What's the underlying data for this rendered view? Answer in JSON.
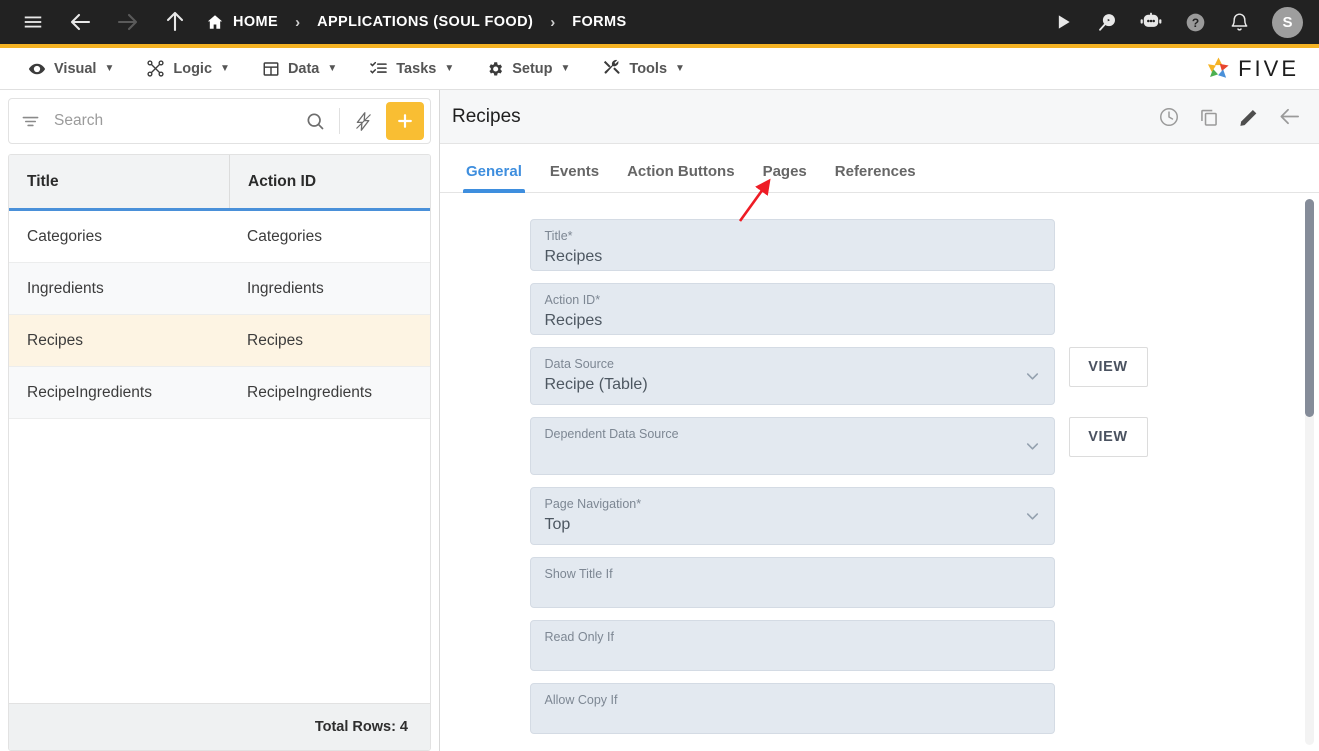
{
  "topbar": {
    "menu_icon": "hamburger-icon",
    "back_icon": "arrow-left-icon",
    "forward_icon": "arrow-right-icon",
    "up_icon": "arrow-up-icon",
    "breadcrumbs": [
      {
        "label": "HOME",
        "icon": "home-icon"
      },
      {
        "label": "APPLICATIONS (SOUL FOOD)",
        "icon": ""
      },
      {
        "label": "FORMS",
        "icon": ""
      }
    ],
    "separator": "›",
    "actions": [
      {
        "name": "run-icon",
        "label": "Run"
      },
      {
        "name": "preview-search-icon",
        "label": "Preview"
      },
      {
        "name": "robot-chat-icon",
        "label": "Assistant"
      },
      {
        "name": "help-icon",
        "label": "Help"
      },
      {
        "name": "notifications-bell-icon",
        "label": "Notifications"
      }
    ],
    "avatar_initial": "S",
    "bg_color": "#222222",
    "accent_color": "#F5B324"
  },
  "menubar": {
    "items": [
      {
        "label": "Visual",
        "icon": "eye-icon",
        "caret": "▼"
      },
      {
        "label": "Logic",
        "icon": "logic-nodes-icon",
        "caret": "▼"
      },
      {
        "label": "Data",
        "icon": "table-grid-icon",
        "caret": "▼"
      },
      {
        "label": "Tasks",
        "icon": "tasks-list-icon",
        "caret": "▼"
      },
      {
        "label": "Setup",
        "icon": "gear-icon",
        "caret": "▼"
      },
      {
        "label": "Tools",
        "icon": "tools-icon",
        "caret": "▼"
      }
    ],
    "brand": {
      "name": "five-logo-icon",
      "word": "FIVE"
    }
  },
  "sidebar": {
    "search": {
      "placeholder": "Search",
      "value": "",
      "filter_icon": "filter-icon",
      "search_icon": "search-icon",
      "bolt_icon": "lightning-bolt-icon",
      "add_icon": "plus-icon"
    },
    "table": {
      "columns": [
        "Title",
        "Action ID"
      ],
      "rows": [
        {
          "title": "Categories",
          "action_id": "Categories",
          "selected": false
        },
        {
          "title": "Ingredients",
          "action_id": "Ingredients",
          "selected": false
        },
        {
          "title": "Recipes",
          "action_id": "Recipes",
          "selected": true
        },
        {
          "title": "RecipeIngredients",
          "action_id": "RecipeIngredients",
          "selected": false
        }
      ],
      "footer": "Total Rows: 4",
      "header_underline_color": "#4a90d9",
      "selected_row_color": "#fdf4e3"
    }
  },
  "detail": {
    "title": "Recipes",
    "header_icons": [
      {
        "name": "history-clock-icon",
        "label": "History"
      },
      {
        "name": "copy-icon",
        "label": "Copy"
      },
      {
        "name": "edit-pencil-icon",
        "label": "Edit"
      },
      {
        "name": "back-arrow-icon",
        "label": "Back"
      }
    ],
    "tabs": [
      {
        "label": "General",
        "active": true
      },
      {
        "label": "Events",
        "active": false
      },
      {
        "label": "Action Buttons",
        "active": false
      },
      {
        "label": "Pages",
        "active": false
      },
      {
        "label": "References",
        "active": false
      }
    ],
    "active_tab_color": "#3e8ede",
    "fields": [
      {
        "label": "Title",
        "required": true,
        "value": "Recipes",
        "type": "text",
        "view_button": false
      },
      {
        "label": "Action ID",
        "required": true,
        "value": "Recipes",
        "type": "text",
        "view_button": false
      },
      {
        "label": "Data Source",
        "required": false,
        "value": "Recipe (Table)",
        "type": "select",
        "view_button": true
      },
      {
        "label": "Dependent Data Source",
        "required": false,
        "value": "",
        "type": "select",
        "view_button": true
      },
      {
        "label": "Page Navigation",
        "required": true,
        "value": "Top",
        "type": "select",
        "view_button": false
      },
      {
        "label": "Show Title If",
        "required": false,
        "value": "",
        "type": "text",
        "view_button": false
      },
      {
        "label": "Read Only If",
        "required": false,
        "value": "",
        "type": "text",
        "view_button": false
      },
      {
        "label": "Allow Copy If",
        "required": false,
        "value": "",
        "type": "text",
        "view_button": false
      }
    ],
    "view_button_label": "VIEW",
    "required_marker": "*"
  },
  "annotation": {
    "name": "red-arrow-pointing-to-pages-tab",
    "color": "#ee1c25",
    "target": "Pages"
  }
}
